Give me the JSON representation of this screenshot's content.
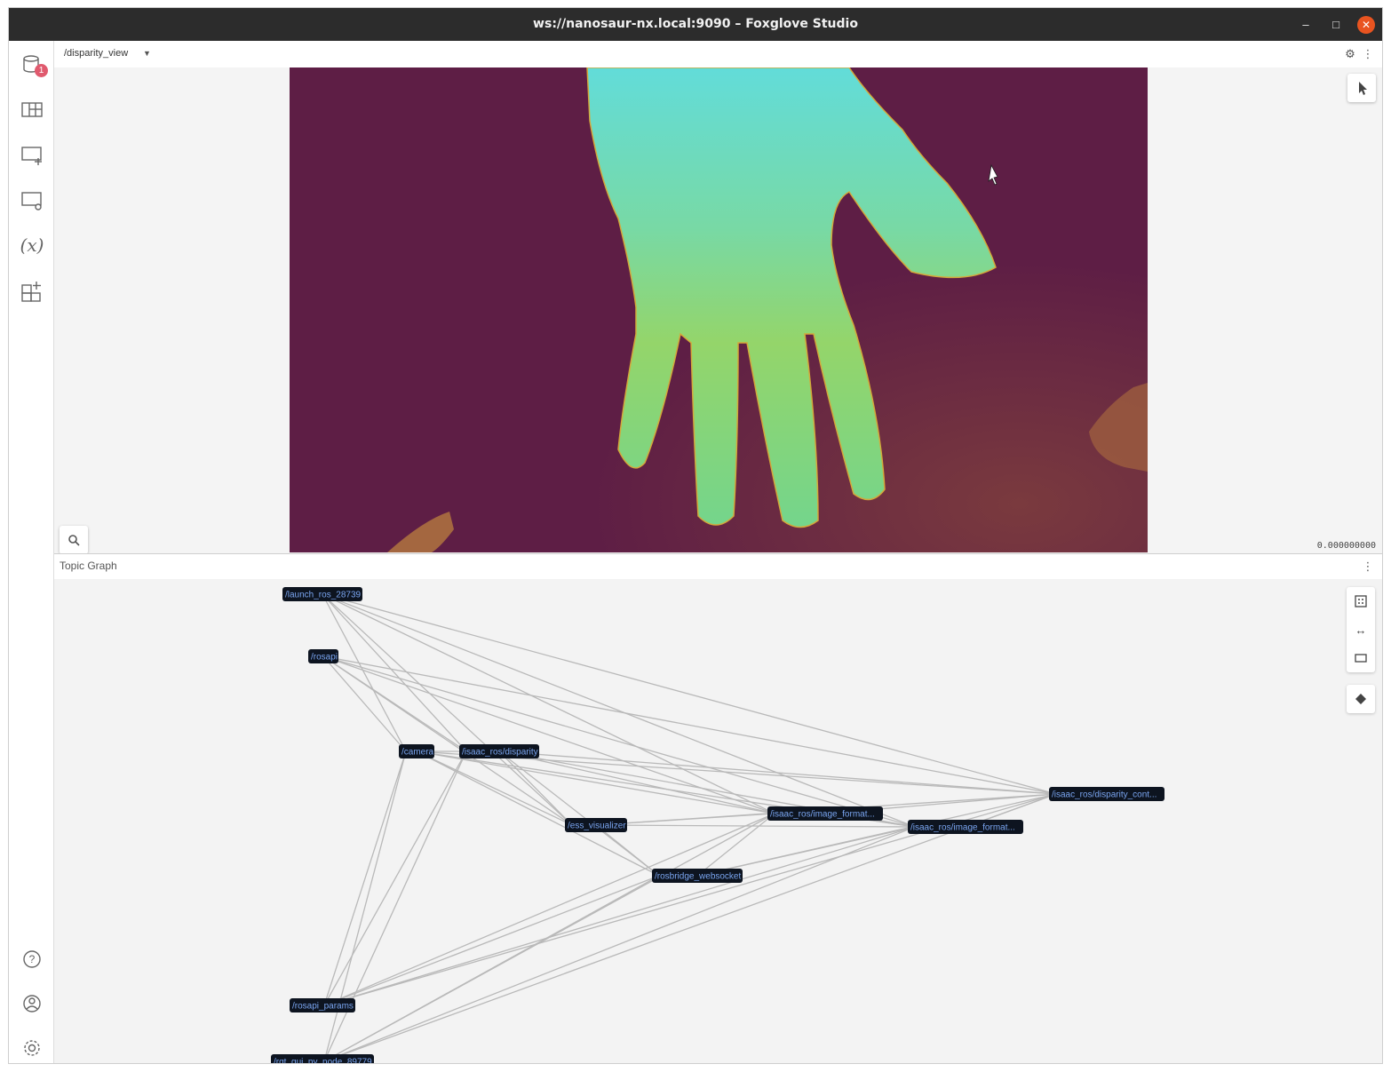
{
  "window": {
    "title": "ws://nanosaur-nx.local:9090 – Foxglove Studio",
    "min": "–",
    "max": "□",
    "close": "✕"
  },
  "sidebar": {
    "badge": "1",
    "variables_label": "(x)",
    "items": [
      "data-source",
      "layouts",
      "add-panel",
      "panel-settings",
      "variables",
      "extensions",
      "help",
      "account",
      "preferences"
    ]
  },
  "image_panel": {
    "topic": "/disparity_view",
    "timestamp": "0.000000000"
  },
  "topic_graph": {
    "title": "Topic Graph",
    "nodes": [
      {
        "id": "launch",
        "label": "/launch_ros_28739"
      },
      {
        "id": "rosapi",
        "label": "/rosapi"
      },
      {
        "id": "camera",
        "label": "/camera"
      },
      {
        "id": "disparity",
        "label": "/isaac_ros/disparity"
      },
      {
        "id": "disp_cont",
        "label": "/isaac_ros/disparity_cont..."
      },
      {
        "id": "ess_vis",
        "label": "/ess_visualizer"
      },
      {
        "id": "img_fmt1",
        "label": "/isaac_ros/image_format..."
      },
      {
        "id": "img_fmt2",
        "label": "/isaac_ros/image_format..."
      },
      {
        "id": "rosbridge",
        "label": "/rosbridge_websocket"
      },
      {
        "id": "rosapi_params",
        "label": "/rosapi_params"
      },
      {
        "id": "rqt",
        "label": "/rqt_gui_py_node_89779"
      }
    ],
    "edges": [
      [
        "launch",
        "camera"
      ],
      [
        "launch",
        "disparity"
      ],
      [
        "launch",
        "disp_cont"
      ],
      [
        "launch",
        "img_fmt1"
      ],
      [
        "launch",
        "img_fmt2"
      ],
      [
        "launch",
        "ess_vis"
      ],
      [
        "rosapi",
        "camera"
      ],
      [
        "rosapi",
        "disparity"
      ],
      [
        "rosapi",
        "disp_cont"
      ],
      [
        "rosapi",
        "img_fmt1"
      ],
      [
        "rosapi",
        "img_fmt2"
      ],
      [
        "rosapi",
        "ess_vis"
      ],
      [
        "camera",
        "disparity"
      ],
      [
        "camera",
        "disp_cont"
      ],
      [
        "camera",
        "img_fmt1"
      ],
      [
        "camera",
        "img_fmt2"
      ],
      [
        "camera",
        "ess_vis"
      ],
      [
        "camera",
        "rosbridge"
      ],
      [
        "disparity",
        "disp_cont"
      ],
      [
        "disparity",
        "img_fmt1"
      ],
      [
        "disparity",
        "img_fmt2"
      ],
      [
        "disparity",
        "ess_vis"
      ],
      [
        "disparity",
        "rosbridge"
      ],
      [
        "ess_vis",
        "img_fmt1"
      ],
      [
        "ess_vis",
        "img_fmt2"
      ],
      [
        "ess_vis",
        "rosbridge"
      ],
      [
        "ess_vis",
        "disp_cont"
      ],
      [
        "img_fmt1",
        "disp_cont"
      ],
      [
        "img_fmt2",
        "disp_cont"
      ],
      [
        "img_fmt1",
        "img_fmt2"
      ],
      [
        "rosbridge",
        "img_fmt1"
      ],
      [
        "rosbridge",
        "img_fmt2"
      ],
      [
        "rosbridge",
        "disp_cont"
      ],
      [
        "rosapi_params",
        "camera"
      ],
      [
        "rosapi_params",
        "disparity"
      ],
      [
        "rosapi_params",
        "img_fmt1"
      ],
      [
        "rosapi_params",
        "img_fmt2"
      ],
      [
        "rosapi_params",
        "disp_cont"
      ],
      [
        "rosapi_params",
        "rosbridge"
      ],
      [
        "rqt",
        "camera"
      ],
      [
        "rqt",
        "disparity"
      ],
      [
        "rqt",
        "img_fmt1"
      ],
      [
        "rqt",
        "img_fmt2"
      ],
      [
        "rqt",
        "disp_cont"
      ],
      [
        "rqt",
        "rosbridge"
      ]
    ]
  },
  "colors": {
    "background_disparity": "#5e1e45",
    "hand": "#7fd37a",
    "node_bg": "#0d1420",
    "node_text": "#7aa5f0",
    "edge": "#b9b9b9"
  }
}
